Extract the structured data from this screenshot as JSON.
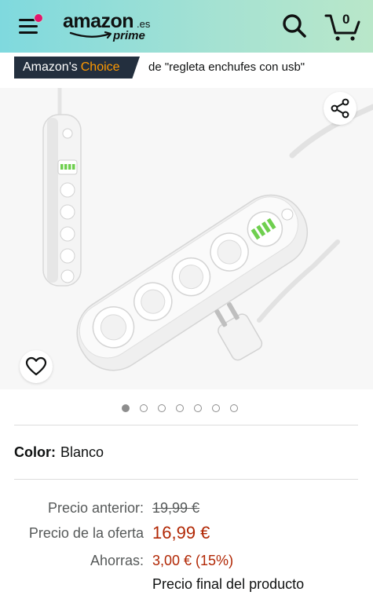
{
  "header": {
    "logo_word": "amazon",
    "logo_tld": ".es",
    "logo_prime": "prime",
    "cart_count": "0"
  },
  "choice": {
    "badge_white": "Amazon's",
    "badge_orange": "Choice",
    "query": "de \"regleta enchufes con usb\""
  },
  "gallery": {
    "image_count": 7,
    "active_index": 0
  },
  "color": {
    "label": "Color:",
    "value": "Blanco"
  },
  "price": {
    "previous_label": "Precio anterior:",
    "previous_value": "19,99 €",
    "deal_label": "Precio de la oferta",
    "deal_value": "16,99 €",
    "savings_label": "Ahorras:",
    "savings_value": "3,00 € (15%)",
    "final_note": "Precio final del producto"
  },
  "colors": {
    "header_start": "#7fd9de",
    "header_end": "#b9e7c9",
    "badge_bg": "#232f3e",
    "badge_accent": "#ff9900",
    "price_red": "#b12704",
    "notification_dot": "#e3166d"
  },
  "icons": [
    "menu-icon",
    "search-icon",
    "cart-icon",
    "share-icon",
    "heart-icon"
  ]
}
